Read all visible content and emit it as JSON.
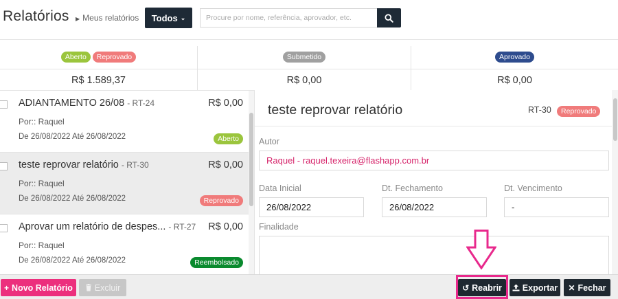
{
  "header": {
    "title": "Relatórios",
    "breadcrumb": "Meus relatórios",
    "filter_label": "Todos",
    "search_placeholder": "Procure por nome, referência, aprovador, etc."
  },
  "summary": [
    {
      "badges": [
        "Aberto",
        "Reprovado"
      ],
      "amount": "R$ 1.589,37"
    },
    {
      "badges": [
        "Submetido"
      ],
      "amount": "R$ 0,00"
    },
    {
      "badges": [
        "Aprovado"
      ],
      "amount": "R$ 0,00"
    }
  ],
  "reports": [
    {
      "title": "ADIANTAMENTO 26/08",
      "ref": "- RT-24",
      "value": "R$ 0,00",
      "by": "Por:: Raquel",
      "dates": "De 26/08/2022 Até 26/08/2022",
      "status": "Aberto"
    },
    {
      "title": "teste reprovar relatório",
      "ref": "- RT-30",
      "value": "R$ 0,00",
      "by": "Por:: Raquel",
      "dates": "De 26/08/2022 Até 26/08/2022",
      "status": "Reprovado"
    },
    {
      "title": "Aprovar um relatório de despes...",
      "ref": "- RT-27",
      "value": "R$ 0,00",
      "by": "Por:: Raquel",
      "dates": "De 26/08/2022 Até 26/08/2022",
      "status": "Reembolsado"
    }
  ],
  "detail": {
    "title": "teste reprovar relatório",
    "ref": "RT-30",
    "status": "Reprovado",
    "author_label": "Autor",
    "author_value": "Raquel - raquel.texeira@flashapp.com.br",
    "start_label": "Data Inicial",
    "start_value": "26/08/2022",
    "close_label": "Dt. Fechamento",
    "close_value": "26/08/2022",
    "due_label": "Dt. Vencimento",
    "due_value": "-",
    "purpose_label": "Finalidade",
    "purpose_value": ""
  },
  "footer": {
    "new_label": "Novo Relatório",
    "delete_label": "Excluir",
    "reopen_label": "Reabrir",
    "export_label": "Exportar",
    "close_label": "Fechar"
  },
  "colors": {
    "accent_pink": "#ec2f7d",
    "dark_button": "#1f2830",
    "status_aberto": "#9bc53d",
    "status_reprovado": "#f07b7b",
    "status_submetido": "#a0a0a0",
    "status_aprovado": "#2e4c8e",
    "status_reembolsado": "#0a8a2e"
  },
  "icons": {
    "search": "search-icon",
    "reopen": "undo-icon",
    "export": "upload-icon",
    "close": "close-icon",
    "new": "plus-icon",
    "delete": "trash-icon"
  }
}
